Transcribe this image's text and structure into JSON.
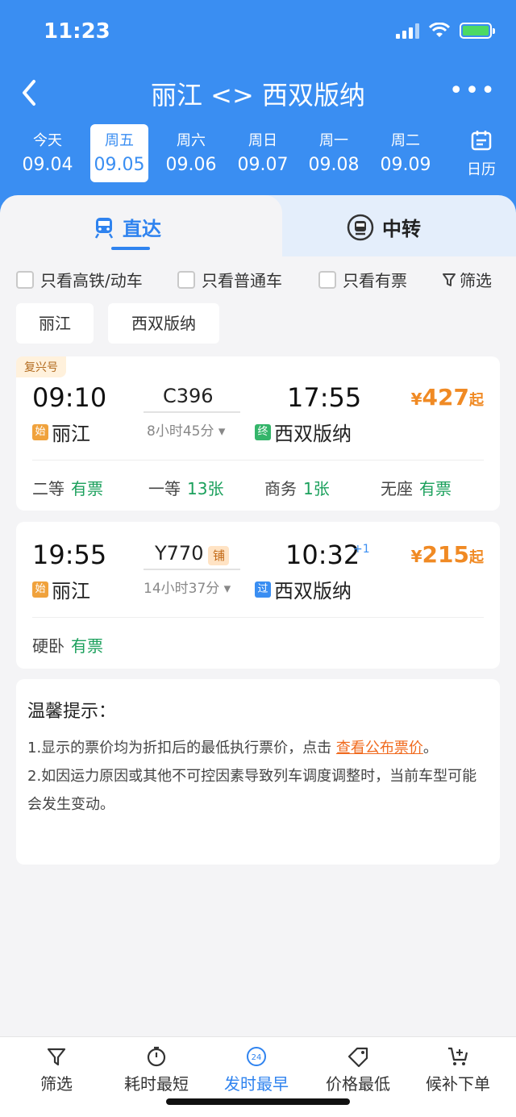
{
  "status_bar": {
    "time": "11:23"
  },
  "header": {
    "title": "丽江 <> 西双版纳",
    "more": "•••"
  },
  "dates": [
    {
      "day": "今天",
      "date": "09.04"
    },
    {
      "day": "周五",
      "date": "09.05"
    },
    {
      "day": "周六",
      "date": "09.06"
    },
    {
      "day": "周日",
      "date": "09.07"
    },
    {
      "day": "周一",
      "date": "09.08"
    },
    {
      "day": "周二",
      "date": "09.09"
    }
  ],
  "calendar_label": "日历",
  "tabs": {
    "direct": "直达",
    "transfer": "中转"
  },
  "filters": {
    "high_speed": "只看高铁/动车",
    "normal": "只看普通车",
    "available": "只看有票",
    "filter": "筛选"
  },
  "stations": {
    "from": "丽江",
    "to": "西双版纳"
  },
  "trains": [
    {
      "badge": "复兴号",
      "dep_time": "09:10",
      "train_no": "C396",
      "duration": "8小时45分",
      "arr_time": "17:55",
      "from_tag": "始",
      "from": "丽江",
      "to_tag": "终",
      "to": "西双版纳",
      "price_currency": "¥",
      "price": "427",
      "price_suffix": "起",
      "seats": [
        {
          "name": "二等",
          "value": "有票"
        },
        {
          "name": "一等",
          "value": "13张"
        },
        {
          "name": "商务",
          "value": "1张"
        },
        {
          "name": "无座",
          "value": "有票"
        }
      ]
    },
    {
      "berth_tag": "铺",
      "dep_time": "19:55",
      "train_no": "Y770",
      "duration": "14小时37分",
      "arr_time": "10:32",
      "arr_plus": "+1",
      "from_tag": "始",
      "from": "丽江",
      "to_tag": "过",
      "to": "西双版纳",
      "price_currency": "¥",
      "price": "215",
      "price_suffix": "起",
      "seats": [
        {
          "name": "硬卧",
          "value": "有票"
        }
      ]
    }
  ],
  "tips": {
    "title": "温馨提示：",
    "line1_prefix": "1.显示的票价均为折扣后的最低执行票价，点击 ",
    "line1_link": "查看公布票价",
    "line1_suffix": "。",
    "line2": "2.如因运力原因或其他不可控因素导致列车调度调整时，当前车型可能会发生变动。"
  },
  "bottom_bar": [
    {
      "label": "筛选"
    },
    {
      "label": "耗时最短"
    },
    {
      "label": "发时最早",
      "icon_text": "24"
    },
    {
      "label": "价格最低"
    },
    {
      "label": "候补下单"
    }
  ],
  "colors": {
    "primary": "#3a8ef2",
    "price": "#f08a24",
    "available": "#1ba05c",
    "link": "#f06a1e"
  }
}
